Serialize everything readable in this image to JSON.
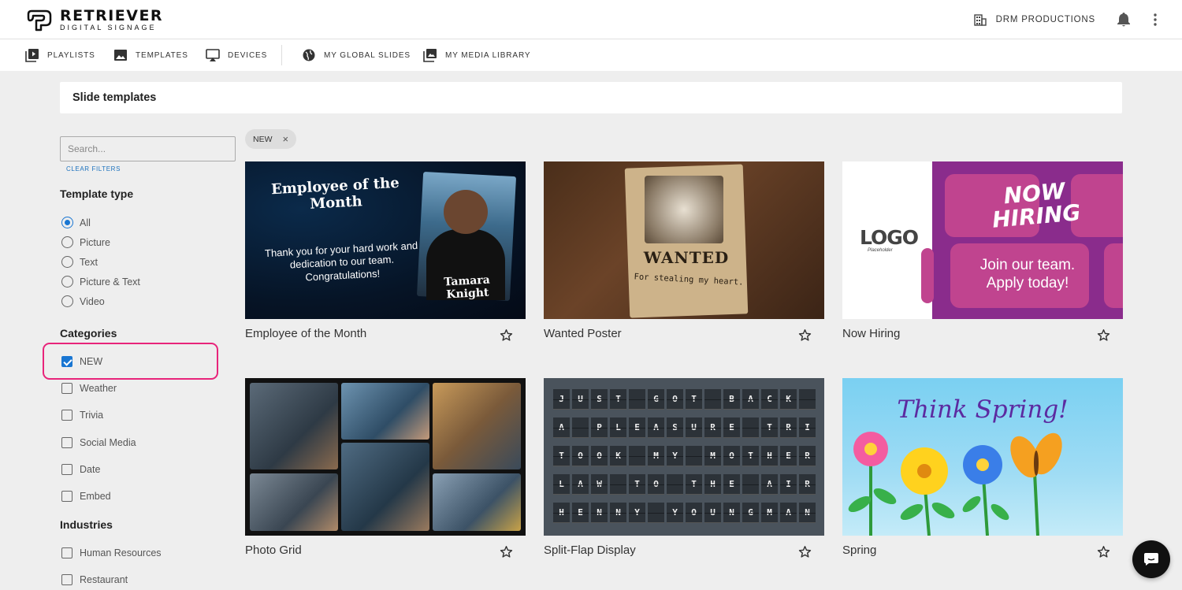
{
  "brand": {
    "name": "RETRIEVER",
    "tagline": "DIGITAL SIGNAGE"
  },
  "header": {
    "org_name": "DRM PRODUCTIONS",
    "org_icon": "building-icon",
    "notifications_icon": "bell-icon",
    "menu_icon": "more-vert-icon"
  },
  "nav": {
    "items": [
      {
        "label": "PLAYLISTS",
        "icon": "playlist-play-icon"
      },
      {
        "label": "TEMPLATES",
        "icon": "image-icon"
      },
      {
        "label": "DEVICES",
        "icon": "cast-screen-icon"
      },
      {
        "label": "MY GLOBAL SLIDES",
        "icon": "globe-icon"
      },
      {
        "label": "MY MEDIA LIBRARY",
        "icon": "photo-library-icon"
      }
    ]
  },
  "page": {
    "title": "Slide templates"
  },
  "filters": {
    "search_placeholder": "Search...",
    "clear_label": "CLEAR FILTERS",
    "template_type_heading": "Template type",
    "template_types": [
      {
        "label": "All",
        "selected": true
      },
      {
        "label": "Picture",
        "selected": false
      },
      {
        "label": "Text",
        "selected": false
      },
      {
        "label": "Picture & Text",
        "selected": false
      },
      {
        "label": "Video",
        "selected": false
      }
    ],
    "categories_heading": "Categories",
    "categories": [
      {
        "label": "NEW",
        "checked": true
      },
      {
        "label": "Weather",
        "checked": false
      },
      {
        "label": "Trivia",
        "checked": false
      },
      {
        "label": "Social Media",
        "checked": false
      },
      {
        "label": "Date",
        "checked": false
      },
      {
        "label": "Embed",
        "checked": false
      }
    ],
    "industries_heading": "Industries",
    "industries": [
      {
        "label": "Human Resources",
        "checked": false
      },
      {
        "label": "Restaurant",
        "checked": false
      }
    ],
    "highlight_color": "#e8247a"
  },
  "active_chip": {
    "label": "NEW",
    "remove": "×"
  },
  "templates": [
    {
      "title": "Employee of the Month",
      "thumb": {
        "heading": "Employee of the Month",
        "body": "Thank you for your hard work and dedication to our team. Congratulations!",
        "name": "Tamara Knight"
      }
    },
    {
      "title": "Wanted Poster",
      "thumb": {
        "heading": "WANTED",
        "body": "For stealing my heart."
      }
    },
    {
      "title": "Now Hiring",
      "thumb": {
        "logo": "LOGO",
        "logo_sub": "Placeholder",
        "heading": "NOW HIRING",
        "body": "Join our team. Apply today!"
      }
    },
    {
      "title": "Photo Grid",
      "thumb": {}
    },
    {
      "title": "Split-Flap Display",
      "thumb": {
        "rows": [
          "JUST GOT BACK FROM",
          "A PLEASURE TRIP: I",
          "TOOK MY MOTHER-IN-",
          "LAW TO THE AIRPORT.",
          "HENNY YOUNGMAN"
        ]
      }
    },
    {
      "title": "Spring",
      "thumb": {
        "heading": "Think Spring!"
      }
    }
  ],
  "colors": {
    "accent": "#1976d2",
    "page_bg": "#eeeeee"
  },
  "chat_icon": "chat-bubble-icon"
}
